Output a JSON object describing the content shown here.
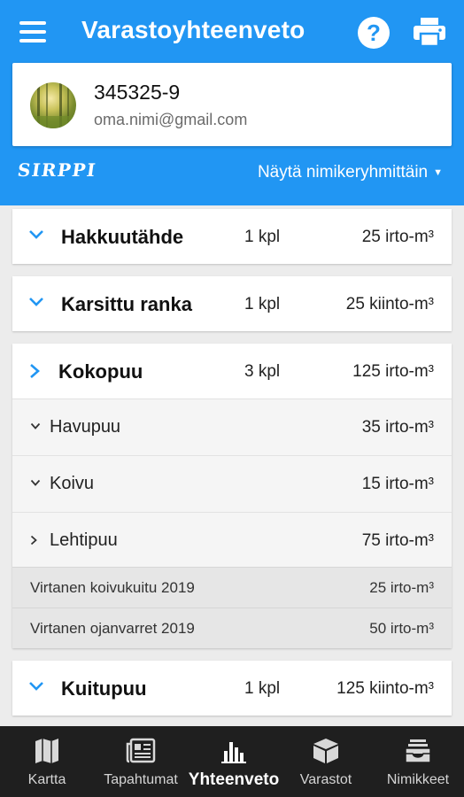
{
  "app": {
    "title": "Varastoyhteenveto",
    "help_glyph": "?"
  },
  "user": {
    "id": "345325-9",
    "email": "oma.nimi@gmail.com"
  },
  "brand": "SIRPPI",
  "grouping": {
    "label": "Näytä nimikeryhmittäin",
    "caret": "▼"
  },
  "groups": [
    {
      "name": "Hakkuutähde",
      "count": "1 kpl",
      "volume": "25 irto-m³",
      "expanded": false
    },
    {
      "name": "Karsittu ranka",
      "count": "1 kpl",
      "volume": "25 kiinto-m³",
      "expanded": false
    },
    {
      "name": "Kokopuu",
      "count": "3 kpl",
      "volume": "125 irto-m³",
      "expanded": true,
      "subgroups": [
        {
          "name": "Havupuu",
          "volume": "35 irto-m³"
        },
        {
          "name": "Koivu",
          "volume": "15 irto-m³"
        },
        {
          "name": "Lehtipuu",
          "volume": "75 irto-m³"
        }
      ],
      "items": [
        {
          "name": "Virtanen koivukuitu 2019",
          "volume": "25 irto-m³"
        },
        {
          "name": "Virtanen ojanvarret 2019",
          "volume": "50 irto-m³"
        }
      ]
    },
    {
      "name": "Kuitupuu",
      "count": "1 kpl",
      "volume": "125 kiinto-m³",
      "expanded": false
    }
  ],
  "nav": [
    {
      "label": "Kartta",
      "icon": "map-icon"
    },
    {
      "label": "Tapahtumat",
      "icon": "newspaper-icon"
    },
    {
      "label": "Yhteenveto",
      "icon": "bar-chart-icon",
      "active": true
    },
    {
      "label": "Varastot",
      "icon": "box-icon"
    },
    {
      "label": "Nimikkeet",
      "icon": "inbox-icon"
    }
  ],
  "colors": {
    "primary": "#2196f3",
    "nav_background": "#1f1f1f",
    "chevron": "#2196f3"
  }
}
